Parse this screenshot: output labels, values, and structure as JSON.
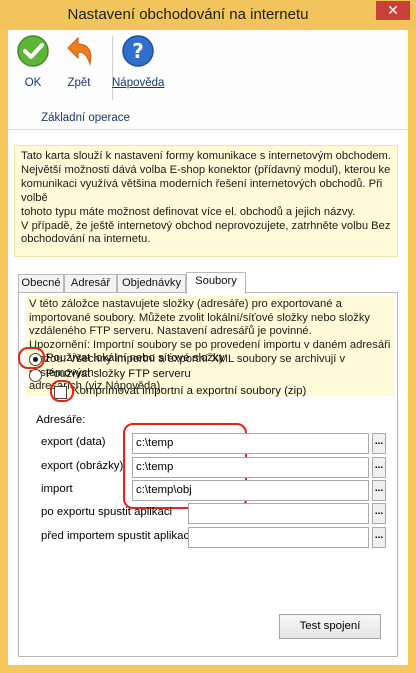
{
  "window": {
    "title": "Nastavení obchodování na internetu",
    "close": "✕"
  },
  "ribbon": {
    "ok_label": "OK",
    "back_label": "Zpět",
    "help_label": "Nápověda",
    "group_label": "Základní operace"
  },
  "info_lines": [
    "Tato karta slouží k nastavení formy komunikace s internetovým obchodem.",
    "Největší možnosti dává volba E-shop konektor (přídavný modul), kterou ke",
    "komunikaci využívá většina moderních řešení internetových obchodů. Při volbě",
    "tohoto typu máte možnost definovat více el. obchodů a jejich názvy.",
    "V případě, že ještě internetový obchod neprovozujete, zatrhněte volbu Bez",
    "obchodování na internetu."
  ],
  "tabs": [
    {
      "label": "Obecné",
      "active": false
    },
    {
      "label": "Adresář",
      "active": false
    },
    {
      "label": "Objednávky",
      "active": false
    },
    {
      "label": "Soubory",
      "active": true
    }
  ],
  "panel_lines": [
    "V této záložce nastavujete složky (adresáře) pro exportované a",
    "importované soubory. Můžete zvolit lokální/síťové složky nebo složky",
    "vzdáleného FTP serveru. Nastavení adresářů je povinné.",
    "Upozornění: Importní soubory se po provedení importu v daném adresáři",
    "mažou. Všechny importní a exportní XML soubory se archivují v systémových",
    "adresářích (viz Nápověda)."
  ],
  "options": {
    "local": {
      "label": "Používat lokální nebo síťové složky",
      "selected": true
    },
    "ftp": {
      "label": "Používat složky FTP serveru",
      "selected": false
    },
    "zip": {
      "label": "Komprimovat importní a exportní soubory (zip)",
      "checked": false
    }
  },
  "folders": {
    "group_label": "Adresáře:",
    "rows": [
      {
        "label": "export (data)",
        "value": "c:\\temp"
      },
      {
        "label": "export (obrázky)",
        "value": "c:\\temp"
      },
      {
        "label": "import",
        "value": "c:\\temp\\obj"
      },
      {
        "label": "po exportu spustit aplikaci",
        "value": ""
      },
      {
        "label": "před importem spustit aplikaci",
        "value": ""
      }
    ],
    "browse_label": "..."
  },
  "test_button": "Test spojení",
  "colors": {
    "highlight": "#e0251b",
    "info_bg": "#fffbd9",
    "frame": "#f6c75a"
  }
}
